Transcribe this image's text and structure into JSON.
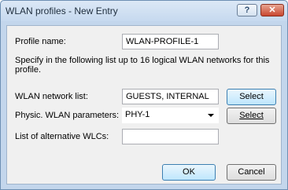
{
  "window": {
    "title": "WLAN profiles - New Entry",
    "help_label": "?",
    "close_label": "✕"
  },
  "form": {
    "profile_name_label": "Profile name:",
    "profile_name_value": "WLAN-PROFILE-1",
    "description": "Specify in the following list up to 16 logical WLAN networks for this profile.",
    "network_list_label": "WLAN network list:",
    "network_list_value": "GUESTS, INTERNAL",
    "select_label": "Select",
    "phy_label": "Physic. WLAN parameters:",
    "phy_value": "PHY-1",
    "select2_label": "Select",
    "alt_wlc_label": "List of alternative WLCs:",
    "alt_wlc_value": ""
  },
  "footer": {
    "ok_label": "OK",
    "cancel_label": "Cancel"
  }
}
